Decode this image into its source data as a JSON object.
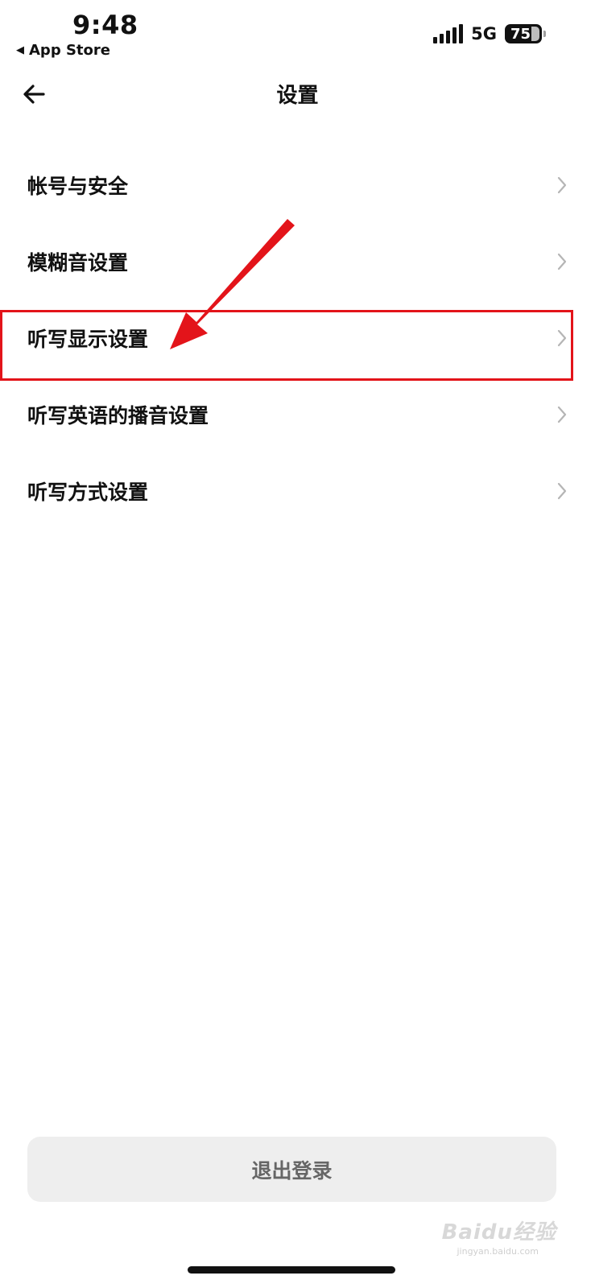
{
  "status_bar": {
    "time": "9:48",
    "back_app": "App Store",
    "network": "5G",
    "battery": "75"
  },
  "header": {
    "title": "设置"
  },
  "menu": {
    "items": [
      {
        "label": "帐号与安全"
      },
      {
        "label": "模糊音设置"
      },
      {
        "label": "听写显示设置"
      },
      {
        "label": "听写英语的播音设置"
      },
      {
        "label": "听写方式设置"
      }
    ]
  },
  "logout": {
    "label": "退出登录"
  },
  "annotation": {
    "color": "#e3141a"
  },
  "watermark": {
    "text": "Baidu经验",
    "sub": "jingyan.baidu.com"
  }
}
